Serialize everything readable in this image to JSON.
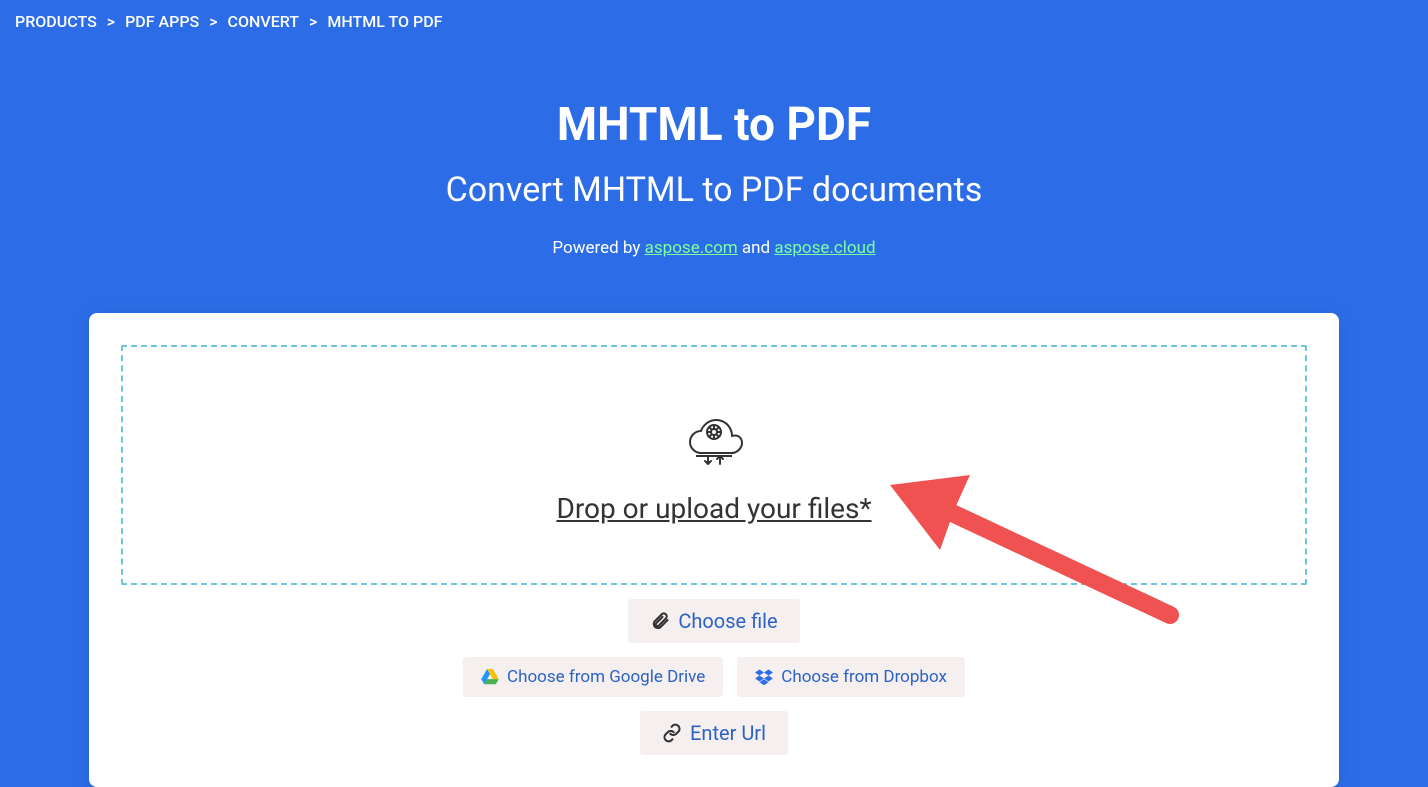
{
  "breadcrumb": {
    "items": [
      "PRODUCTS",
      "PDF APPS",
      "CONVERT",
      "MHTML TO PDF"
    ]
  },
  "hero": {
    "title": "MHTML to PDF",
    "subtitle": "Convert MHTML to PDF documents",
    "powered_prefix": "Powered by ",
    "powered_link1": "aspose.com",
    "powered_and": " and ",
    "powered_link2": "aspose.cloud"
  },
  "dropzone": {
    "label": "Drop or upload your files*"
  },
  "buttons": {
    "choose_file": "Choose file",
    "google_drive": "Choose from Google Drive",
    "dropbox": "Choose from Dropbox",
    "enter_url": "Enter Url"
  },
  "colors": {
    "bg": "#2C6DE7",
    "accent_green": "#7CFF9E",
    "btn_bg": "#F5EFEF",
    "btn_text": "#2C62C5",
    "dashed": "#6EC6D9",
    "arrow": "#F05252"
  }
}
